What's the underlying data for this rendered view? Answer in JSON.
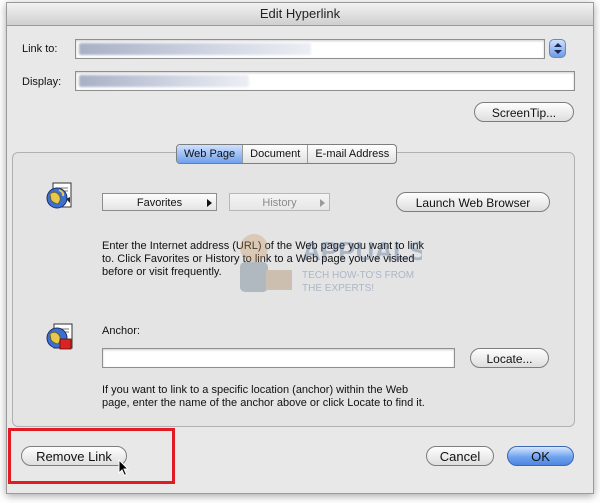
{
  "window": {
    "title": "Edit Hyperlink"
  },
  "link_to": {
    "label": "Link to:"
  },
  "display": {
    "label": "Display:"
  },
  "screentip_button": "ScreenTip...",
  "tabs": [
    {
      "label": "Web Page",
      "active": true
    },
    {
      "label": "Document",
      "active": false
    },
    {
      "label": "E-mail Address",
      "active": false
    }
  ],
  "web_page": {
    "favorites_label": "Favorites",
    "history_label": "History",
    "launch_button": "Launch Web Browser",
    "instructions": [
      "Enter the Internet address (URL) of the Web page you want to link",
      "to. Click Favorites or History to link to a Web page you've visited",
      "before or visit frequently."
    ]
  },
  "anchor": {
    "label": "Anchor:",
    "value": "",
    "locate_button": "Locate...",
    "instructions": [
      "If you want to link to a specific location (anchor) within the Web",
      "page, enter the name of the anchor above or click Locate to find it."
    ]
  },
  "footer": {
    "remove_link_button": "Remove Link",
    "cancel_button": "Cancel",
    "ok_button": "OK"
  },
  "watermark": {
    "brand": "APPUALS",
    "tagline_1": "TECH HOW-TO'S FROM",
    "tagline_2": "THE EXPERTS!"
  },
  "colors": {
    "highlight": "#e01b24",
    "default_button": "#5b8fe4",
    "window_bg": "#e8e8e8"
  }
}
